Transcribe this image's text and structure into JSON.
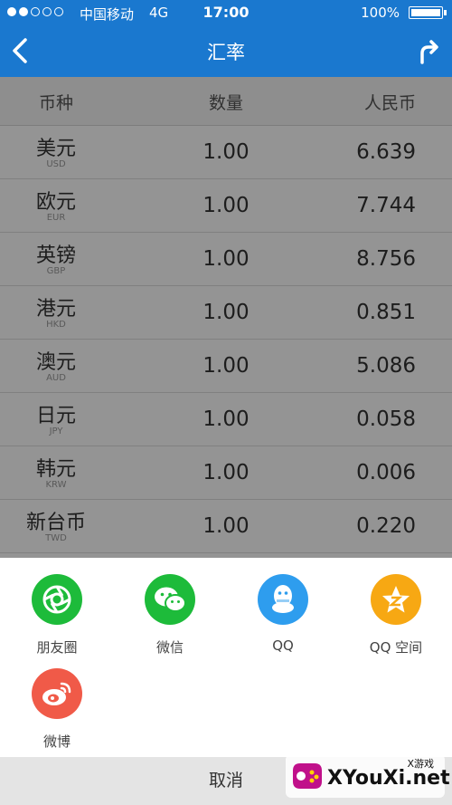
{
  "status_bar": {
    "carrier": "中国移动",
    "network": "4G",
    "time": "17:00",
    "battery": "100%"
  },
  "nav": {
    "title": "汇率"
  },
  "table": {
    "headers": [
      "币种",
      "数量",
      "人民币"
    ],
    "rows": [
      {
        "name": "美元",
        "code": "USD",
        "qty": "1.00",
        "rmb": "6.639"
      },
      {
        "name": "欧元",
        "code": "EUR",
        "qty": "1.00",
        "rmb": "7.744"
      },
      {
        "name": "英镑",
        "code": "GBP",
        "qty": "1.00",
        "rmb": "8.756"
      },
      {
        "name": "港元",
        "code": "HKD",
        "qty": "1.00",
        "rmb": "0.851"
      },
      {
        "name": "澳元",
        "code": "AUD",
        "qty": "1.00",
        "rmb": "5.086"
      },
      {
        "name": "日元",
        "code": "JPY",
        "qty": "1.00",
        "rmb": "0.058"
      },
      {
        "name": "韩元",
        "code": "KRW",
        "qty": "1.00",
        "rmb": "0.006"
      },
      {
        "name": "新台币",
        "code": "TWD",
        "qty": "1.00",
        "rmb": "0.220"
      }
    ]
  },
  "share": {
    "items": [
      {
        "label": "朋友圈",
        "icon": "moments-icon",
        "color": "#1dbb3a"
      },
      {
        "label": "微信",
        "icon": "wechat-icon",
        "color": "#1dbb3a"
      },
      {
        "label": "QQ",
        "icon": "qq-icon",
        "color": "#2e9dee"
      },
      {
        "label": "QQ 空间",
        "icon": "qzone-icon",
        "color": "#f7a813"
      },
      {
        "label": "微博",
        "icon": "weibo-icon",
        "color": "#f05a48"
      }
    ],
    "cancel": "取消"
  },
  "watermark": {
    "top": "X游戏",
    "main": "XYouXi.net"
  }
}
